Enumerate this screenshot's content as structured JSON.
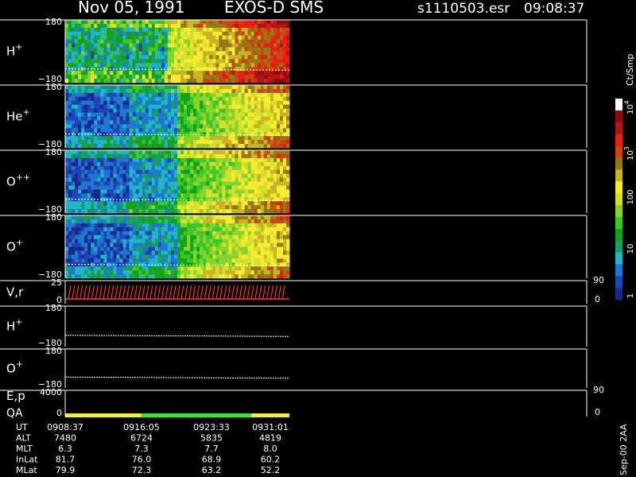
{
  "header": {
    "date": "Nov 05, 1991",
    "instrument": "EXOS-D SMS",
    "file": "s1110503.esr",
    "start_time": "09:08:37"
  },
  "footer_note": "Sep-00 2AA",
  "colors": {
    "background": "#000000",
    "frame": "#ffffff",
    "spectrogram_low": "#102a8c",
    "spectrogram_high": "#b01010",
    "vector_trace": "#ff3030",
    "quality_good": "#f0f040",
    "quality_mid": "#40e040"
  },
  "colorbar": {
    "unit_label": "Ct/Smp",
    "tick_labels": [
      "1",
      "10",
      "100",
      "10",
      "10"
    ],
    "tick_exponents": [
      "",
      "",
      "",
      "3",
      "4"
    ],
    "scale": "log",
    "range": [
      1,
      10000
    ],
    "colors": [
      "#1a2a8a",
      "#1e46b4",
      "#1e78d2",
      "#20b4c8",
      "#18a060",
      "#18a018",
      "#3cc828",
      "#8cd22c",
      "#d2e12c",
      "#f5eb32",
      "#c8b424",
      "#967814",
      "#c84614",
      "#e61e14",
      "#b41414",
      "#8c0a0a",
      "#ffffff"
    ]
  },
  "chart_data": {
    "type": "heatmap",
    "time_ticks": [
      "0908:37",
      "0916:05",
      "0923:33",
      "0931:01"
    ],
    "data_extent_fraction": 0.43,
    "panels": [
      {
        "name_base": "H",
        "name_sup": "+",
        "kind": "spectrogram",
        "yticks": [
          "180",
          "−180"
        ],
        "yrange": [
          -180,
          180
        ]
      },
      {
        "name_base": "He",
        "name_sup": "+",
        "kind": "spectrogram",
        "yticks": [
          "180",
          "−180"
        ],
        "yrange": [
          -180,
          180
        ]
      },
      {
        "name_base": "O",
        "name_sup": "++",
        "kind": "spectrogram",
        "yticks": [
          "180",
          "−180"
        ],
        "yrange": [
          -180,
          180
        ]
      },
      {
        "name_base": "O",
        "name_sup": "+",
        "kind": "spectrogram",
        "yticks": [
          "180",
          "−180"
        ],
        "yrange": [
          -180,
          180
        ]
      },
      {
        "name_base": "V,r",
        "name_sup": "",
        "kind": "vector",
        "yticks": [
          "25",
          "0"
        ],
        "yrange": [
          0,
          25
        ],
        "rticks": [
          "90",
          "0"
        ]
      },
      {
        "name_base": "H",
        "name_sup": "+",
        "kind": "trace",
        "yticks": [
          "180",
          "−180"
        ],
        "yrange": [
          -180,
          180
        ]
      },
      {
        "name_base": "O",
        "name_sup": "+",
        "kind": "trace",
        "yticks": [
          "180",
          "−180"
        ],
        "yrange": [
          -180,
          180
        ]
      },
      {
        "name_base": "E,p",
        "name_sup": "",
        "name2": "QA",
        "kind": "quality",
        "yticks": [
          "4000",
          "0"
        ],
        "yrange": [
          0,
          4000
        ],
        "rticks": [
          "90",
          "0"
        ]
      }
    ],
    "quality_segments": [
      {
        "from": 0.0,
        "to": 0.34,
        "color": "#f0f040"
      },
      {
        "from": 0.34,
        "to": 0.83,
        "color": "#40e040"
      },
      {
        "from": 0.83,
        "to": 1.0,
        "color": "#f0f040"
      }
    ],
    "ephemeris": [
      {
        "label": "UT",
        "values": [
          "0908:37",
          "0916:05",
          "0923:33",
          "0931:01"
        ]
      },
      {
        "label": "ALT",
        "values": [
          "7480",
          "6724",
          "5835",
          "4819"
        ]
      },
      {
        "label": "MLT",
        "values": [
          "6.3",
          "7.3",
          "7.7",
          "8.0"
        ]
      },
      {
        "label": "InLat",
        "values": [
          "81.7",
          "76.0",
          "68.9",
          "60.2"
        ]
      },
      {
        "label": "MLat",
        "values": [
          "79.9",
          "72.3",
          "63.2",
          "52.2"
        ]
      }
    ]
  }
}
